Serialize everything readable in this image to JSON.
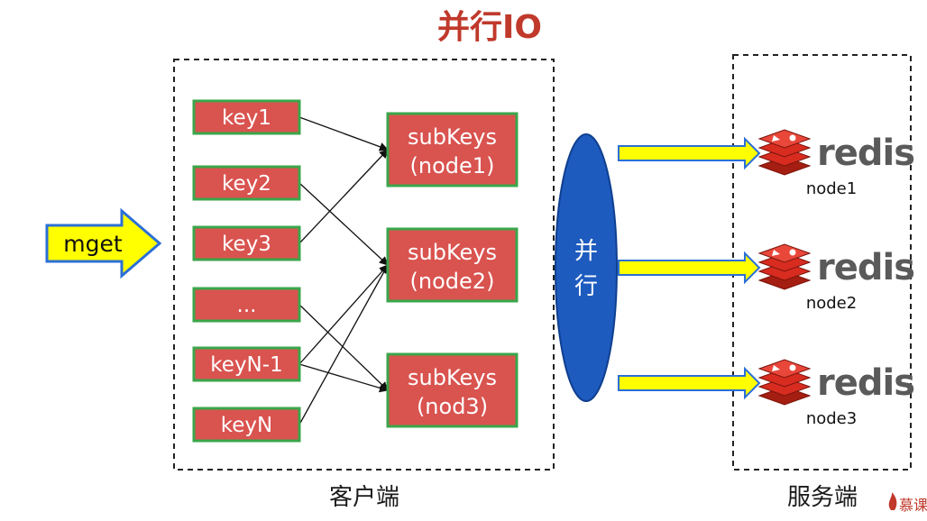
{
  "title": "并行IO",
  "input": {
    "label": "mget"
  },
  "client": {
    "label": "客户端",
    "keys": [
      "key1",
      "key2",
      "key3",
      "...",
      "keyN-1",
      "keyN"
    ],
    "subkeys": [
      {
        "line1": "subKeys",
        "line2": "(node1)"
      },
      {
        "line1": "subKeys",
        "line2": "(node2)"
      },
      {
        "line1": "subKeys",
        "line2": "(nod3)"
      }
    ],
    "links": [
      [
        0,
        0
      ],
      [
        1,
        1
      ],
      [
        2,
        0
      ],
      [
        3,
        2
      ],
      [
        4,
        1
      ],
      [
        4,
        2
      ],
      [
        5,
        1
      ]
    ]
  },
  "parallel": {
    "line1": "并",
    "line2": "行"
  },
  "server": {
    "label": "服务端",
    "nodes": [
      {
        "brand": "redis",
        "name": "node1"
      },
      {
        "brand": "redis",
        "name": "node2"
      },
      {
        "brand": "redis",
        "name": "node3"
      }
    ]
  },
  "watermark": "慕课",
  "colors": {
    "key_fill": "#d9534f",
    "key_border": "#3aa64a",
    "title": "#c0392b",
    "oval": "#1e5bbf",
    "arrow_fill": "#ffff00",
    "arrow_stroke": "#2b6fd6",
    "redis_red": "#d82c20"
  }
}
